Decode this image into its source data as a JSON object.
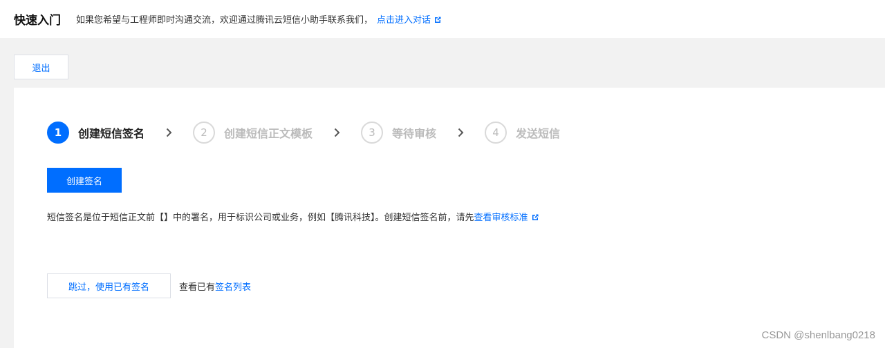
{
  "header": {
    "title": "快速入门",
    "description": "如果您希望与工程师即时沟通交流，欢迎通过腾讯云短信小助手联系我们，",
    "link_label": "点击进入对话",
    "link_icon": "external-link-icon"
  },
  "exit_button": "退出",
  "steps": [
    {
      "number": "1",
      "label": "创建短信签名",
      "active": true
    },
    {
      "number": "2",
      "label": "创建短信正文模板",
      "active": false
    },
    {
      "number": "3",
      "label": "等待审核",
      "active": false
    },
    {
      "number": "4",
      "label": "发送短信",
      "active": false
    }
  ],
  "step_separator_icon": "chevron-right-icon",
  "create_button": "创建签名",
  "intro": {
    "text": "短信签名是位于短信正文前【】中的署名，用于标识公司或业务，例如【腾讯科技】。创建短信签名前，请先",
    "link_label": "查看审核标准",
    "link_icon": "external-link-icon"
  },
  "skip_button": "跳过，使用已有签名",
  "view_list": {
    "prefix": "查看已有",
    "link_label": "签名列表"
  },
  "watermark": "CSDN @shenlbang0218",
  "colors": {
    "accent": "#006eff",
    "page_bg": "#f2f2f2",
    "inactive_step": "#bbbbbb"
  }
}
